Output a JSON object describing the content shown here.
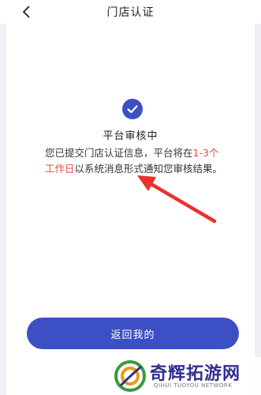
{
  "nav": {
    "title": "门店认证",
    "back_icon": "chevron-left-icon"
  },
  "status": {
    "icon": "check-circle-icon",
    "title": "平台审核中",
    "message_before": "您已提交门店认证信息，平台将在",
    "message_highlight": "1-3个工作日",
    "message_after": "以系统消息形式通知您审核结果。",
    "accent_color": "#3d4fc4",
    "highlight_color": "#e8493f"
  },
  "actions": {
    "back_label": "返回我的"
  },
  "watermark": {
    "text": "奇辉拓游网",
    "subtext": "QIHUI TUOYOU NETWORK"
  }
}
